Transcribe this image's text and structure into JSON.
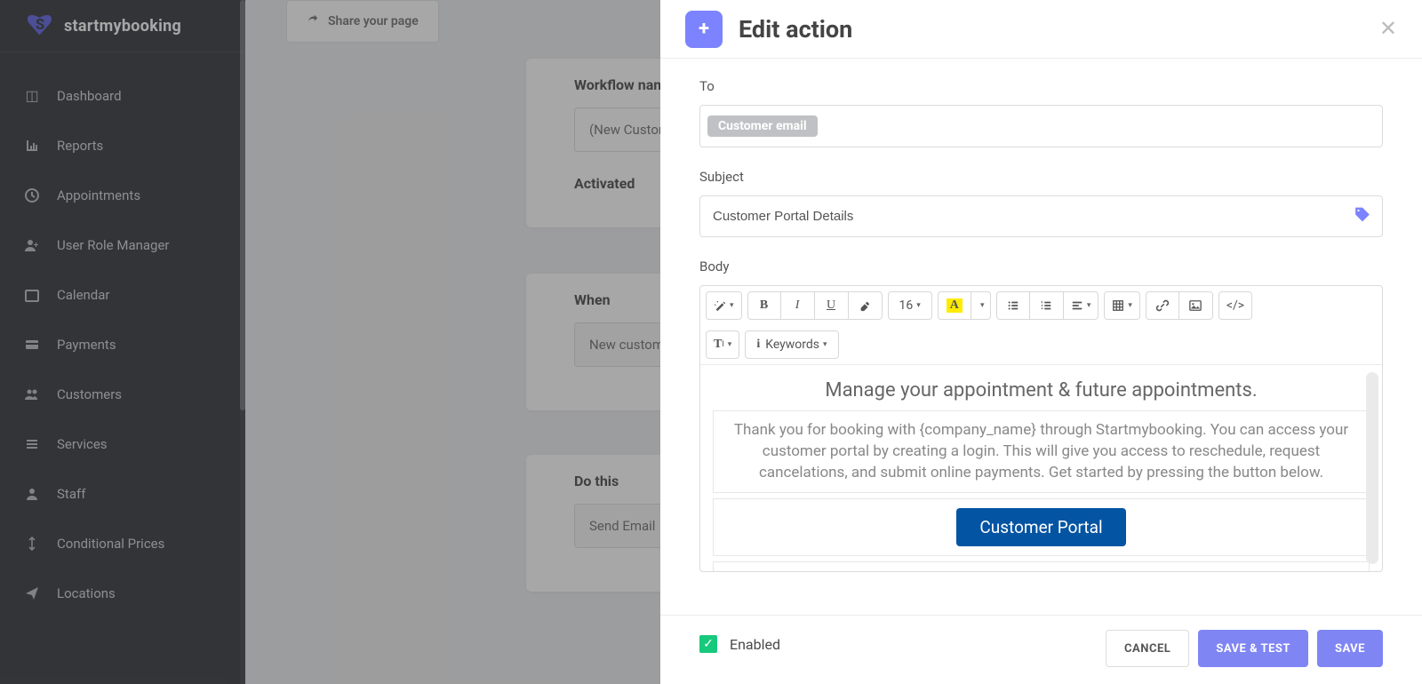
{
  "brand": {
    "name": "startmybooking"
  },
  "sidebar": {
    "items": [
      {
        "label": "Dashboard",
        "icon": "cube-icon"
      },
      {
        "label": "Reports",
        "icon": "chart-icon"
      },
      {
        "label": "Appointments",
        "icon": "clock-icon"
      },
      {
        "label": "User Role Manager",
        "icon": "user-plus-icon"
      },
      {
        "label": "Calendar",
        "icon": "calendar-icon"
      },
      {
        "label": "Payments",
        "icon": "wallet-icon"
      },
      {
        "label": "Customers",
        "icon": "users-icon"
      },
      {
        "label": "Services",
        "icon": "list-icon"
      },
      {
        "label": "Staff",
        "icon": "person-icon"
      },
      {
        "label": "Conditional Prices",
        "icon": "cursor-icon"
      },
      {
        "label": "Locations",
        "icon": "paper-plane-icon"
      }
    ]
  },
  "share": {
    "label": "Share your page"
  },
  "workflow": {
    "name_label": "Workflow name",
    "name_value": "(New Customer",
    "activated_label": "Activated",
    "when_label": "When",
    "when_value": "New customer",
    "do_label": "Do this",
    "do_value": "Send Email"
  },
  "modal": {
    "title": "Edit action",
    "to_label": "To",
    "to_chip": "Customer email",
    "subject_label": "Subject",
    "subject_value": "Customer Portal Details",
    "body_label": "Body",
    "toolbar": {
      "font_size": "16",
      "keywords_label": "Keywords"
    },
    "content": {
      "title": "Manage your appointment & future appointments.",
      "body": "Thank you for booking with {company_name} through Startmybooking. You can access your customer portal by creating a login. This will give you access to reschedule, request cancelations, and submit online payments. Get started by pressing the button below.",
      "cta": "Customer Portal"
    },
    "footer": {
      "enabled_label": "Enabled",
      "cancel": "CANCEL",
      "savetest": "SAVE & TEST",
      "save": "SAVE"
    }
  }
}
